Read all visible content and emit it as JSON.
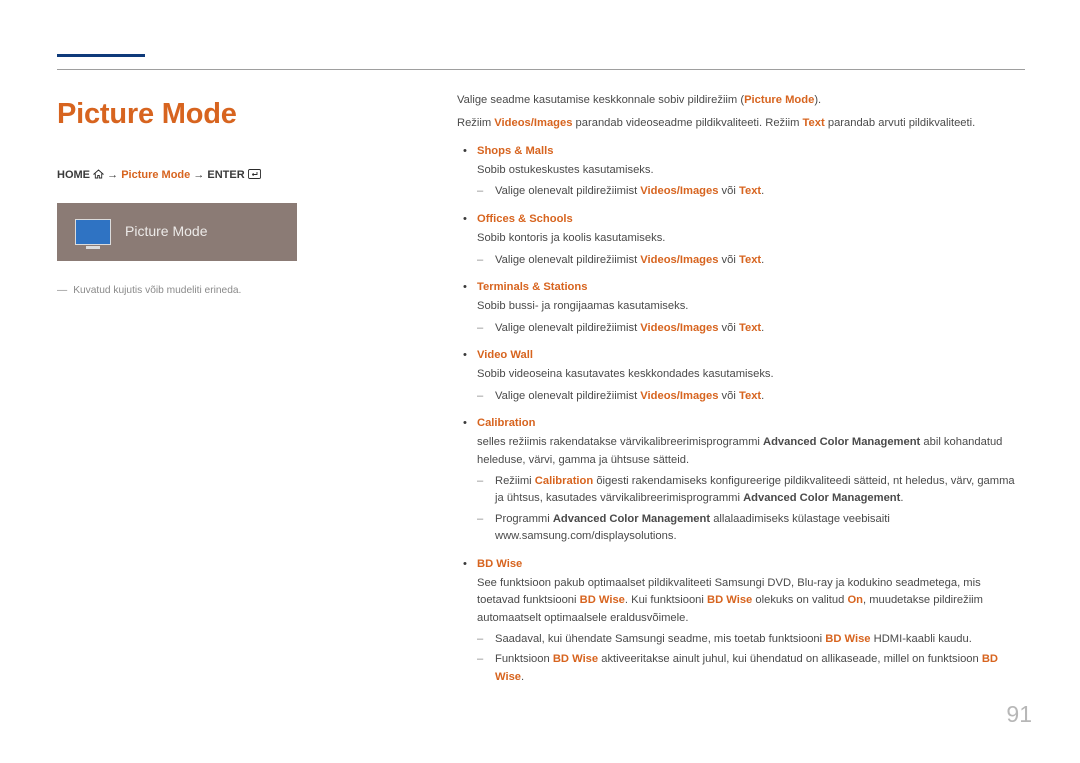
{
  "page_title": "Picture Mode",
  "nav": {
    "home": "HOME",
    "arrow": " → ",
    "mid": "Picture Mode",
    "arrow2": " → ",
    "enter": "ENTER"
  },
  "card_label": "Picture Mode",
  "left_note": "Kuvatud kujutis võib mudeliti erineda.",
  "intro": {
    "line1_pre": "Valige seadme kasutamise keskkonnale sobiv pildirežiim (",
    "line1_hl": "Picture Mode",
    "line1_post": ").",
    "line2_pre": "Režiim ",
    "line2_hl1": "Videos/Images",
    "line2_mid": " parandab videoseadme pildikvaliteeti. Režiim ",
    "line2_hl2": "Text",
    "line2_post": " parandab arvuti pildikvaliteeti."
  },
  "modes": [
    {
      "name": "Shops & Malls",
      "desc": "Sobib ostukeskustes kasutamiseks.",
      "sub": [
        {
          "pre": "Valige olenevalt pildirežiimist ",
          "hl1": "Videos/Images",
          "mid": " või ",
          "hl2": "Text",
          "post": "."
        }
      ]
    },
    {
      "name": "Offices & Schools",
      "desc": "Sobib kontoris ja koolis kasutamiseks.",
      "sub": [
        {
          "pre": "Valige olenevalt pildirežiimist ",
          "hl1": "Videos/Images",
          "mid": " või ",
          "hl2": "Text",
          "post": "."
        }
      ]
    },
    {
      "name": "Terminals & Stations",
      "desc": "Sobib bussi- ja rongijaamas kasutamiseks.",
      "sub": [
        {
          "pre": "Valige olenevalt pildirežiimist ",
          "hl1": "Videos/Images",
          "mid": " või ",
          "hl2": "Text",
          "post": "."
        }
      ]
    },
    {
      "name": "Video Wall",
      "desc": "Sobib videoseina kasutavates keskkondades kasutamiseks.",
      "sub": [
        {
          "pre": "Valige olenevalt pildirežiimist ",
          "hl1": "Videos/Images",
          "mid": " või ",
          "hl2": "Text",
          "post": "."
        }
      ]
    }
  ],
  "calibration": {
    "name": "Calibration",
    "desc_pre": "selles režiimis rakendatakse värvikalibreerimisprogrammi ",
    "desc_bold": "Advanced Color Management",
    "desc_post": " abil kohandatud heleduse, värvi, gamma ja ühtsuse sätteid.",
    "sub1_pre": "Režiimi ",
    "sub1_hl": "Calibration",
    "sub1_mid": " õigesti rakendamiseks konfigureerige pildikvaliteedi sätteid, nt heledus, värv, gamma ja ühtsus, kasutades värvikalibreerimisprogrammi ",
    "sub1_bold": "Advanced Color Management",
    "sub1_post": ".",
    "sub2_pre": "Programmi ",
    "sub2_bold": "Advanced Color Management",
    "sub2_post": " allalaadimiseks külastage veebisaiti www.samsung.com/displaysolutions."
  },
  "bdwise": {
    "name": "BD Wise",
    "desc_pre": "See funktsioon pakub optimaalset pildikvaliteeti Samsungi DVD, Blu-ray ja kodukino seadmetega, mis toetavad funktsiooni ",
    "desc_hl1": "BD Wise",
    "desc_mid1": ". Kui funktsiooni ",
    "desc_hl2": "BD Wise",
    "desc_mid2": " olekuks on valitud ",
    "desc_hl3": "On",
    "desc_post": ", muudetakse pildirežiim automaatselt optimaalsele eraldusvõimele.",
    "sub1_pre": "Saadaval, kui ühendate Samsungi seadme, mis toetab funktsiooni ",
    "sub1_hl": "BD Wise",
    "sub1_post": " HDMI-kaabli kaudu.",
    "sub2_pre": "Funktsioon ",
    "sub2_hl1": "BD Wise",
    "sub2_mid": " aktiveeritakse ainult juhul, kui ühendatud on allikaseade, millel on funktsioon ",
    "sub2_hl2": "BD Wise",
    "sub2_post": "."
  },
  "page_number": "91"
}
